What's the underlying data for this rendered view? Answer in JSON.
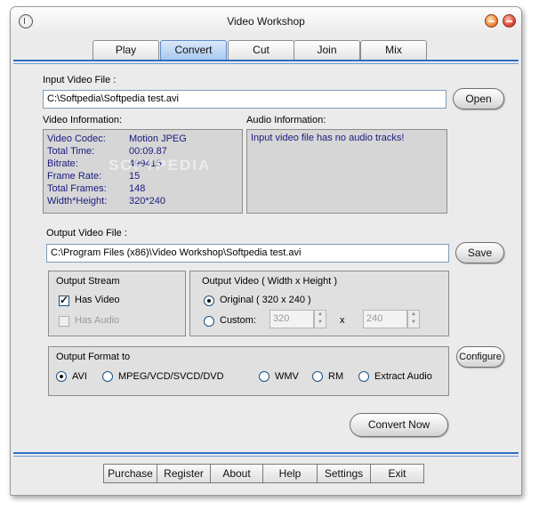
{
  "window": {
    "title": "Video Workshop"
  },
  "tabs": [
    {
      "label": "Play",
      "active": false
    },
    {
      "label": "Convert",
      "active": true
    },
    {
      "label": "Cut",
      "active": false
    },
    {
      "label": "Join",
      "active": false
    },
    {
      "label": "Mix",
      "active": false
    }
  ],
  "input": {
    "label": "Input Video File :",
    "value": "C:\\Softpedia\\Softpedia test.avi",
    "open_label": "Open"
  },
  "video_info": {
    "label": "Video Information:",
    "rows": [
      {
        "key": "Video Codec:",
        "value": "Motion JPEG"
      },
      {
        "key": "Total Time:",
        "value": "00:09.87"
      },
      {
        "key": "Bitrate:",
        "value": "499415"
      },
      {
        "key": "Frame Rate:",
        "value": "15"
      },
      {
        "key": "Total Frames:",
        "value": "148"
      },
      {
        "key": "Width*Height:",
        "value": "320*240"
      }
    ],
    "watermark": "SOFTPEDIA"
  },
  "audio_info": {
    "label": "Audio Information:",
    "text": "Input video file has no audio tracks!"
  },
  "output": {
    "label": "Output Video File :",
    "value": "C:\\Program Files (x86)\\Video Workshop\\Softpedia test.avi",
    "save_label": "Save"
  },
  "output_stream": {
    "title": "Output Stream",
    "has_video_label": "Has Video",
    "has_video_checked": true,
    "has_audio_label": "Has Audio",
    "has_audio_checked": false
  },
  "output_video": {
    "title": "Output Video ( Width x Height )",
    "original_label": "Original ( 320 x 240 )",
    "custom_label": "Custom:",
    "selected": "original",
    "custom_width": "320",
    "custom_height": "240",
    "times": "x"
  },
  "output_format": {
    "title": "Output Format to",
    "options": [
      "AVI",
      "MPEG/VCD/SVCD/DVD",
      "WMV",
      "RM",
      "Extract Audio"
    ],
    "selected": "AVI",
    "configure_label": "Configure"
  },
  "convert_now_label": "Convert Now",
  "bottom_buttons": [
    "Purchase",
    "Register",
    "About",
    "Help",
    "Settings",
    "Exit"
  ],
  "colors": {
    "accent_blue": "#2f6fc6",
    "info_text": "#1a1a80"
  }
}
